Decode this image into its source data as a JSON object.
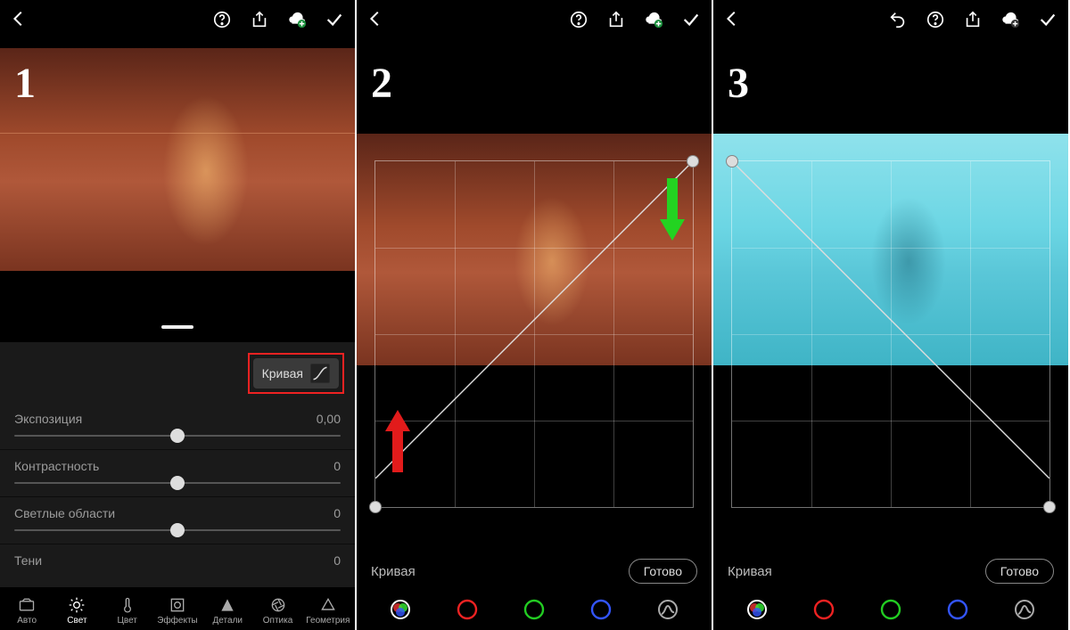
{
  "steps": {
    "s1": "1",
    "s2": "2",
    "s3": "3"
  },
  "panel1": {
    "curve_button_label": "Кривая",
    "sliders": {
      "exposure": {
        "label": "Экспозиция",
        "value": "0,00"
      },
      "contrast": {
        "label": "Контрастность",
        "value": "0"
      },
      "highlights": {
        "label": "Светлые области",
        "value": "0"
      },
      "shadows": {
        "label": "Тени",
        "value": "0"
      }
    },
    "bottom_nav": {
      "auto": "Авто",
      "light": "Свет",
      "color": "Цвет",
      "effects": "Эффекты",
      "detail": "Детали",
      "optics": "Оптика",
      "geometry": "Геометрия"
    }
  },
  "curve_panel": {
    "label": "Кривая",
    "done": "Готово"
  },
  "channel_icons": {
    "rgb": "rgb-circle-icon",
    "red": "red-channel-icon",
    "green": "green-channel-icon",
    "blue": "blue-channel-icon",
    "para": "parametric-icon"
  }
}
